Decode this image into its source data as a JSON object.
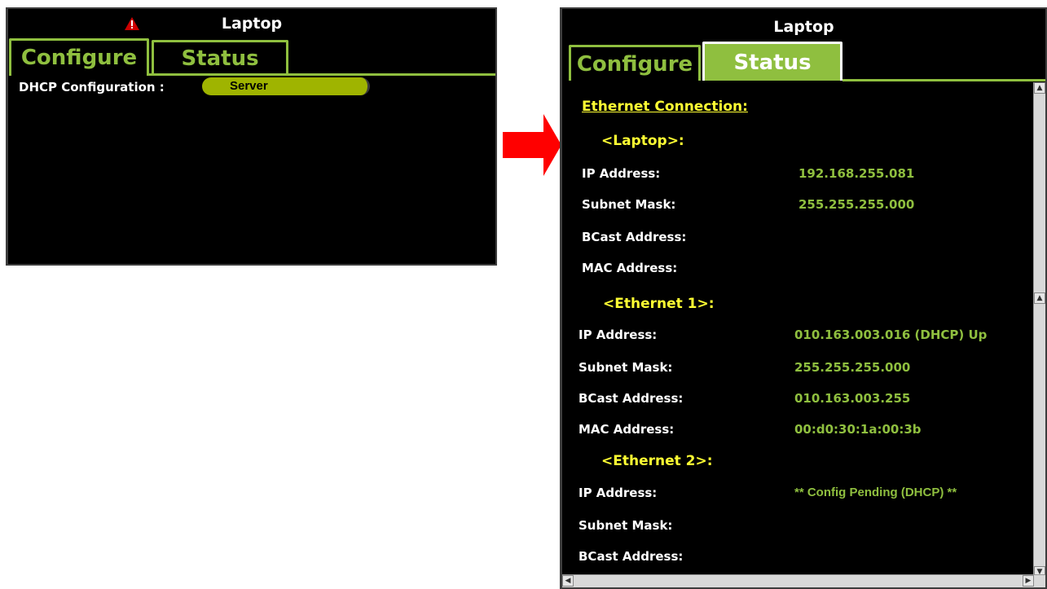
{
  "left": {
    "title": "Laptop",
    "tabs": {
      "configure": "Configure",
      "status": "Status"
    },
    "dhcp_label": "DHCP Configuration :",
    "dhcp_value": "Server"
  },
  "right": {
    "title": "Laptop",
    "tabs": {
      "configure": "Configure",
      "status": "Status"
    },
    "section_title": "Ethernet Connection:",
    "laptop": {
      "header": "<Laptop>:",
      "ip_label": "IP Address:",
      "ip_value": "192.168.255.081",
      "mask_label": "Subnet Mask:",
      "mask_value": "255.255.255.000",
      "bcast_label": "BCast Address:",
      "mac_label": "MAC Address:"
    },
    "eth1": {
      "header": "<Ethernet 1>:",
      "ip_label": "IP Address:",
      "ip_value": "010.163.003.016 (DHCP) Up",
      "mask_label": "Subnet Mask:",
      "mask_value": "255.255.255.000",
      "bcast_label": "BCast Address:",
      "bcast_value": "010.163.003.255",
      "mac_label": "MAC Address:",
      "mac_value": "00:d0:30:1a:00:3b"
    },
    "eth2": {
      "header": "<Ethernet 2>:",
      "ip_label": "IP Address:",
      "ip_value": "** Config Pending (DHCP) **",
      "mask_label": "Subnet Mask:",
      "bcast_label": "BCast Address:"
    }
  },
  "colors": {
    "accent_green": "#8fbf3f",
    "header_yellow": "#ffff33",
    "arrow_red": "#ff0000",
    "warning_red": "#cc0000"
  },
  "icons": {
    "warning": "warning-icon",
    "arrow": "right-arrow-icon"
  }
}
